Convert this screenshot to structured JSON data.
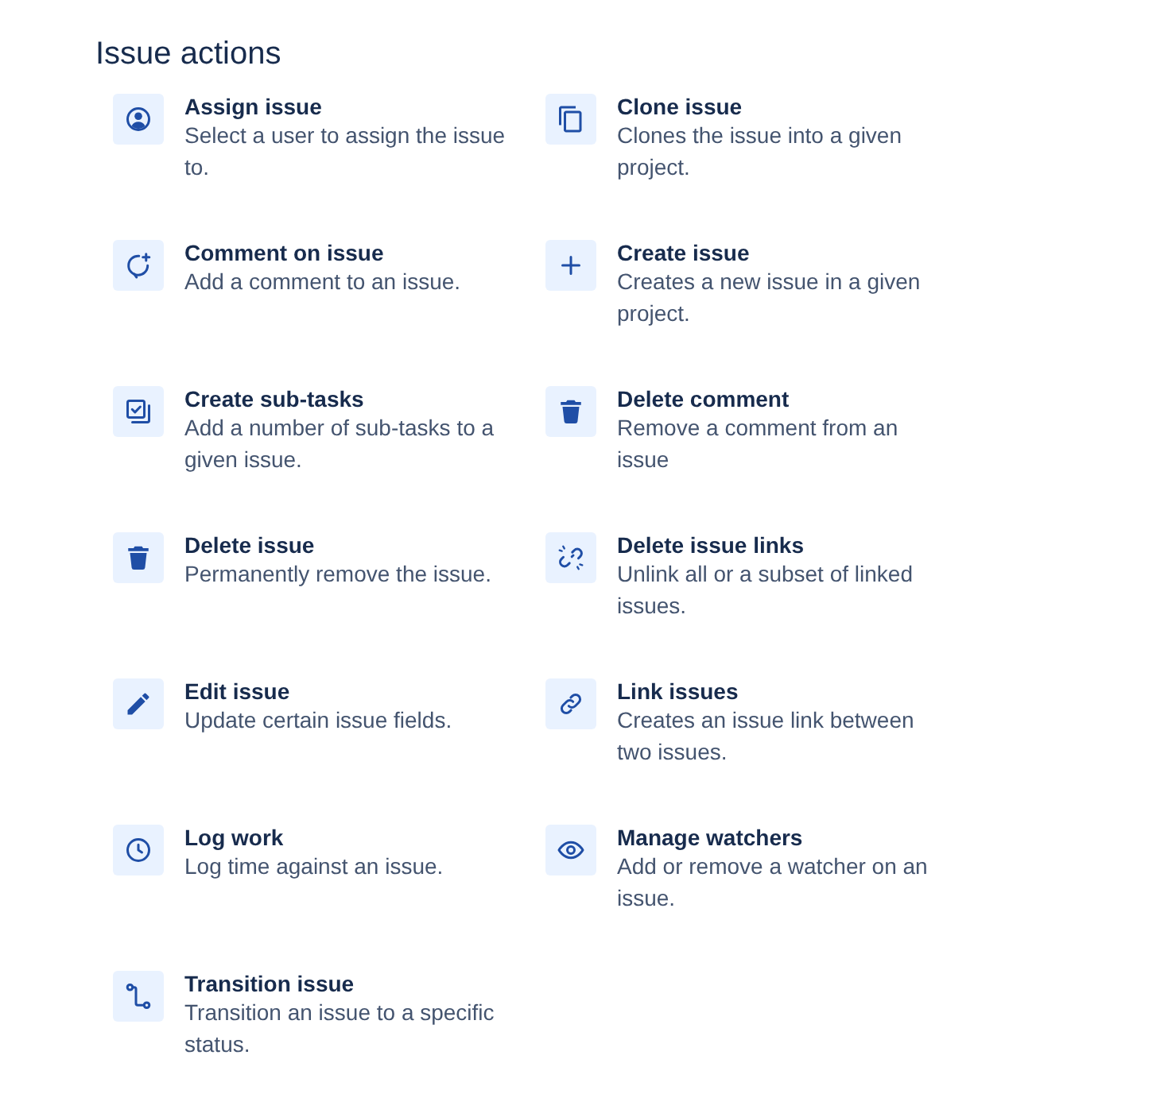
{
  "heading": "Issue actions",
  "actions": [
    {
      "kind": "assign",
      "title": "Assign issue",
      "description": "Select a user to assign the issue to."
    },
    {
      "kind": "clone",
      "title": "Clone issue",
      "description": "Clones the issue into a given project."
    },
    {
      "kind": "comment",
      "title": "Comment on issue",
      "description": "Add a comment to an issue."
    },
    {
      "kind": "create",
      "title": "Create issue",
      "description": "Creates a new issue in a given project."
    },
    {
      "kind": "subtasks",
      "title": "Create sub-tasks",
      "description": "Add a number of sub-tasks to a given issue."
    },
    {
      "kind": "delete",
      "title": "Delete comment",
      "description": "Remove a comment from an issue"
    },
    {
      "kind": "delete",
      "title": "Delete issue",
      "description": "Permanently remove the issue."
    },
    {
      "kind": "unlink",
      "title": "Delete issue links",
      "description": "Unlink all or a subset of linked issues."
    },
    {
      "kind": "edit",
      "title": "Edit issue",
      "description": "Update certain issue fields."
    },
    {
      "kind": "link",
      "title": "Link issues",
      "description": "Creates an issue link between two issues."
    },
    {
      "kind": "log",
      "title": "Log work",
      "description": "Log time against an issue."
    },
    {
      "kind": "watch",
      "title": "Manage watchers",
      "description": "Add or remove a watcher on an issue."
    },
    {
      "kind": "transition",
      "title": "Transition issue",
      "description": "Transition an issue to a specific status."
    }
  ]
}
